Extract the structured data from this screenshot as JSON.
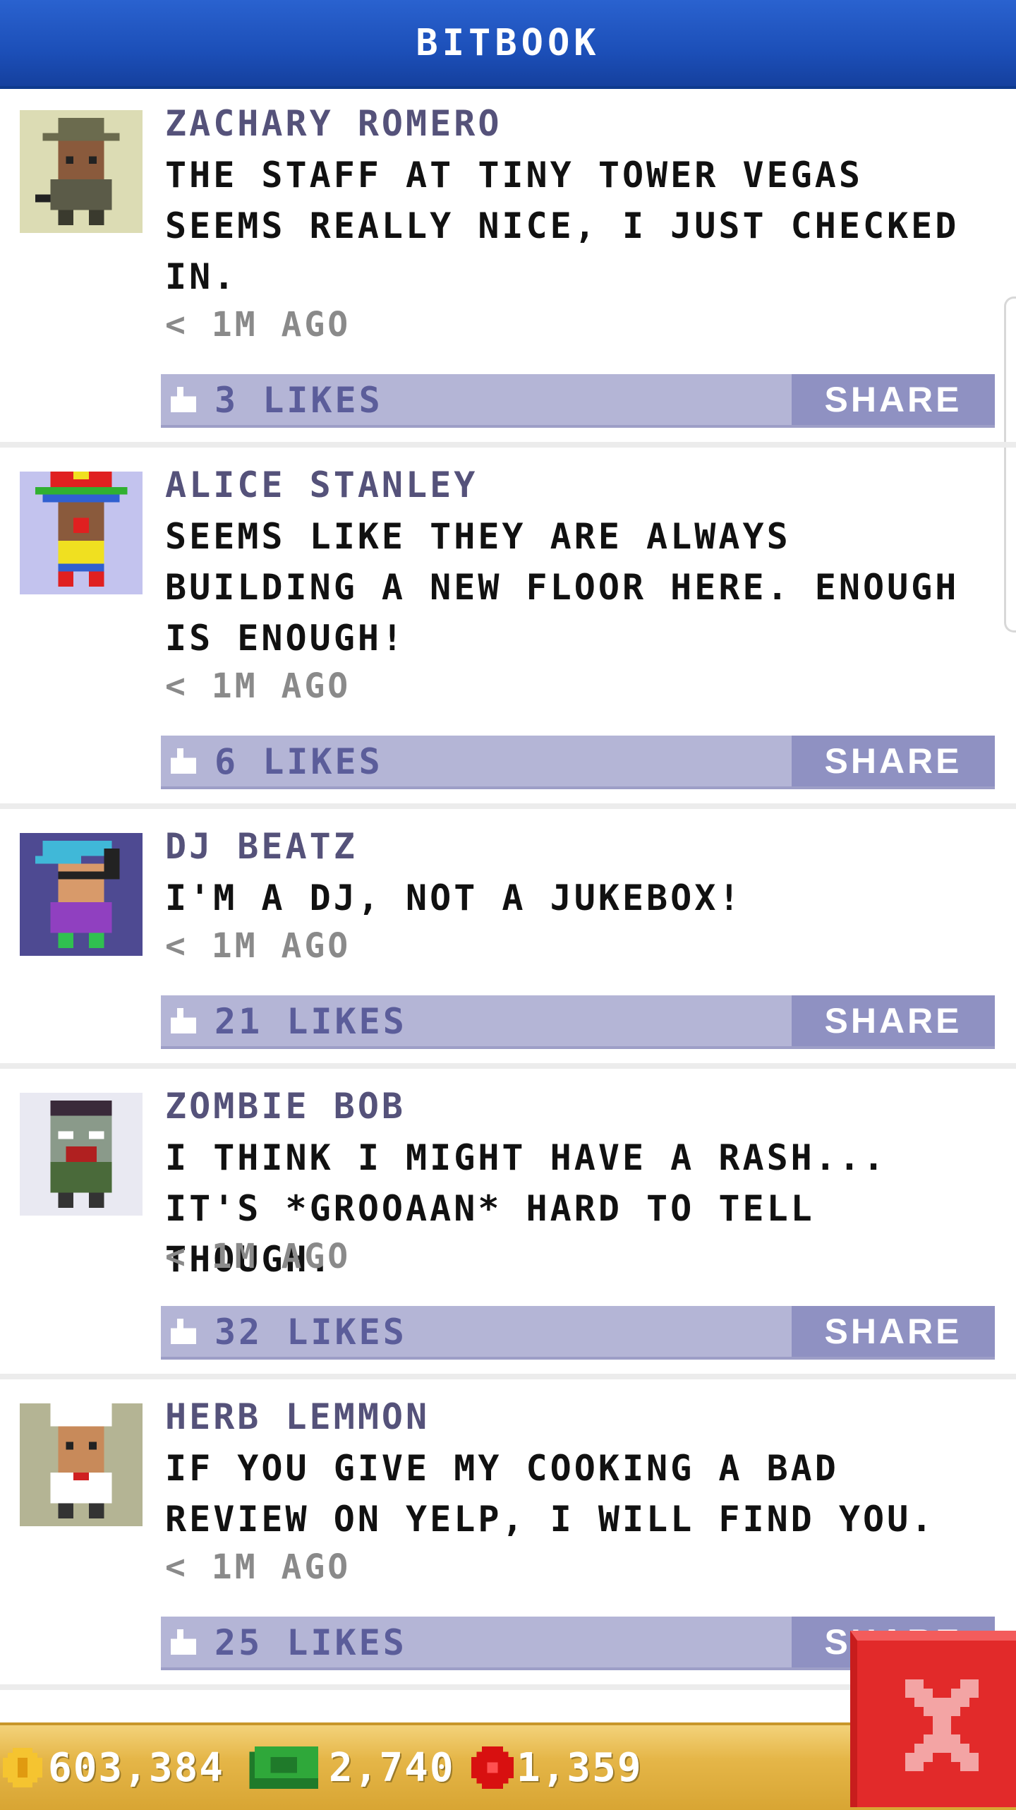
{
  "header": {
    "title": "BITBOOK"
  },
  "posts": [
    {
      "name": "ZACHARY ROMERO",
      "text": "THE STAFF AT TINY TOWER VEGAS SEEMS REALLY NICE, I JUST CHECKED IN.",
      "time": "< 1M AGO",
      "likes": "3 LIKES",
      "share": "SHARE",
      "avatar_bg": "#dcdcb4"
    },
    {
      "name": "ALICE STANLEY",
      "text": "SEEMS LIKE THEY ARE ALWAYS BUILDING A NEW FLOOR HERE. ENOUGH IS ENOUGH!",
      "time": "< 1M AGO",
      "likes": "6 LIKES",
      "share": "SHARE",
      "avatar_bg": "#c3c3ee"
    },
    {
      "name": "DJ BEATZ",
      "text": "I'M A DJ, NOT A JUKEBOX!",
      "time": "< 1M AGO",
      "likes": "21 LIKES",
      "share": "SHARE",
      "avatar_bg": "#4e4a92"
    },
    {
      "name": "ZOMBIE BOB",
      "text": "I THINK I MIGHT HAVE A RASH... IT'S *GROOAAN* HARD TO TELL THOUGH.",
      "time": "< 1M AGO",
      "likes": "32 LIKES",
      "share": "SHARE",
      "avatar_bg": "#e9e9f2"
    },
    {
      "name": "HERB LEMMON",
      "text": "IF YOU GIVE MY COOKING A BAD REVIEW ON YELP, I WILL FIND YOU.",
      "time": "< 1M AGO",
      "likes": "25 LIKES",
      "share": "SHARE",
      "avatar_bg": "#b4b494"
    }
  ],
  "currency": {
    "coins": "603,384",
    "bux": "2,740",
    "points": "1,359"
  },
  "colors": {
    "header": "#1c4fb8",
    "like_bar": "#b4b5d6",
    "share_button": "#8f91c2",
    "bottom_bar": "#e5b648",
    "close_button": "#e22a2a"
  }
}
